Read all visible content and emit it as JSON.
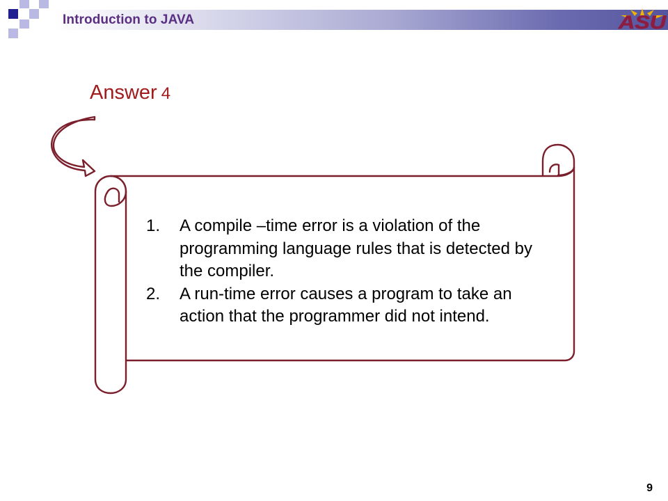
{
  "header": {
    "title": "Introduction to JAVA",
    "logo_text": "ASU"
  },
  "slide": {
    "title": "Answer",
    "title_number": "4",
    "items": [
      {
        "number": "1.",
        "text": "A compile –time error is a violation of the programming language rules that is detected by the compiler."
      },
      {
        "number": "2.",
        "text": "A run-time error causes a program to take an action that the programmer did not intend."
      }
    ],
    "page_number": "9"
  },
  "colors": {
    "accent": "#a01c1c",
    "scroll_stroke": "#7a1f2b",
    "header_text": "#5a2f82",
    "corner_squares": "#1f1f8f",
    "corner_squares_light": "#b9b9e3"
  }
}
